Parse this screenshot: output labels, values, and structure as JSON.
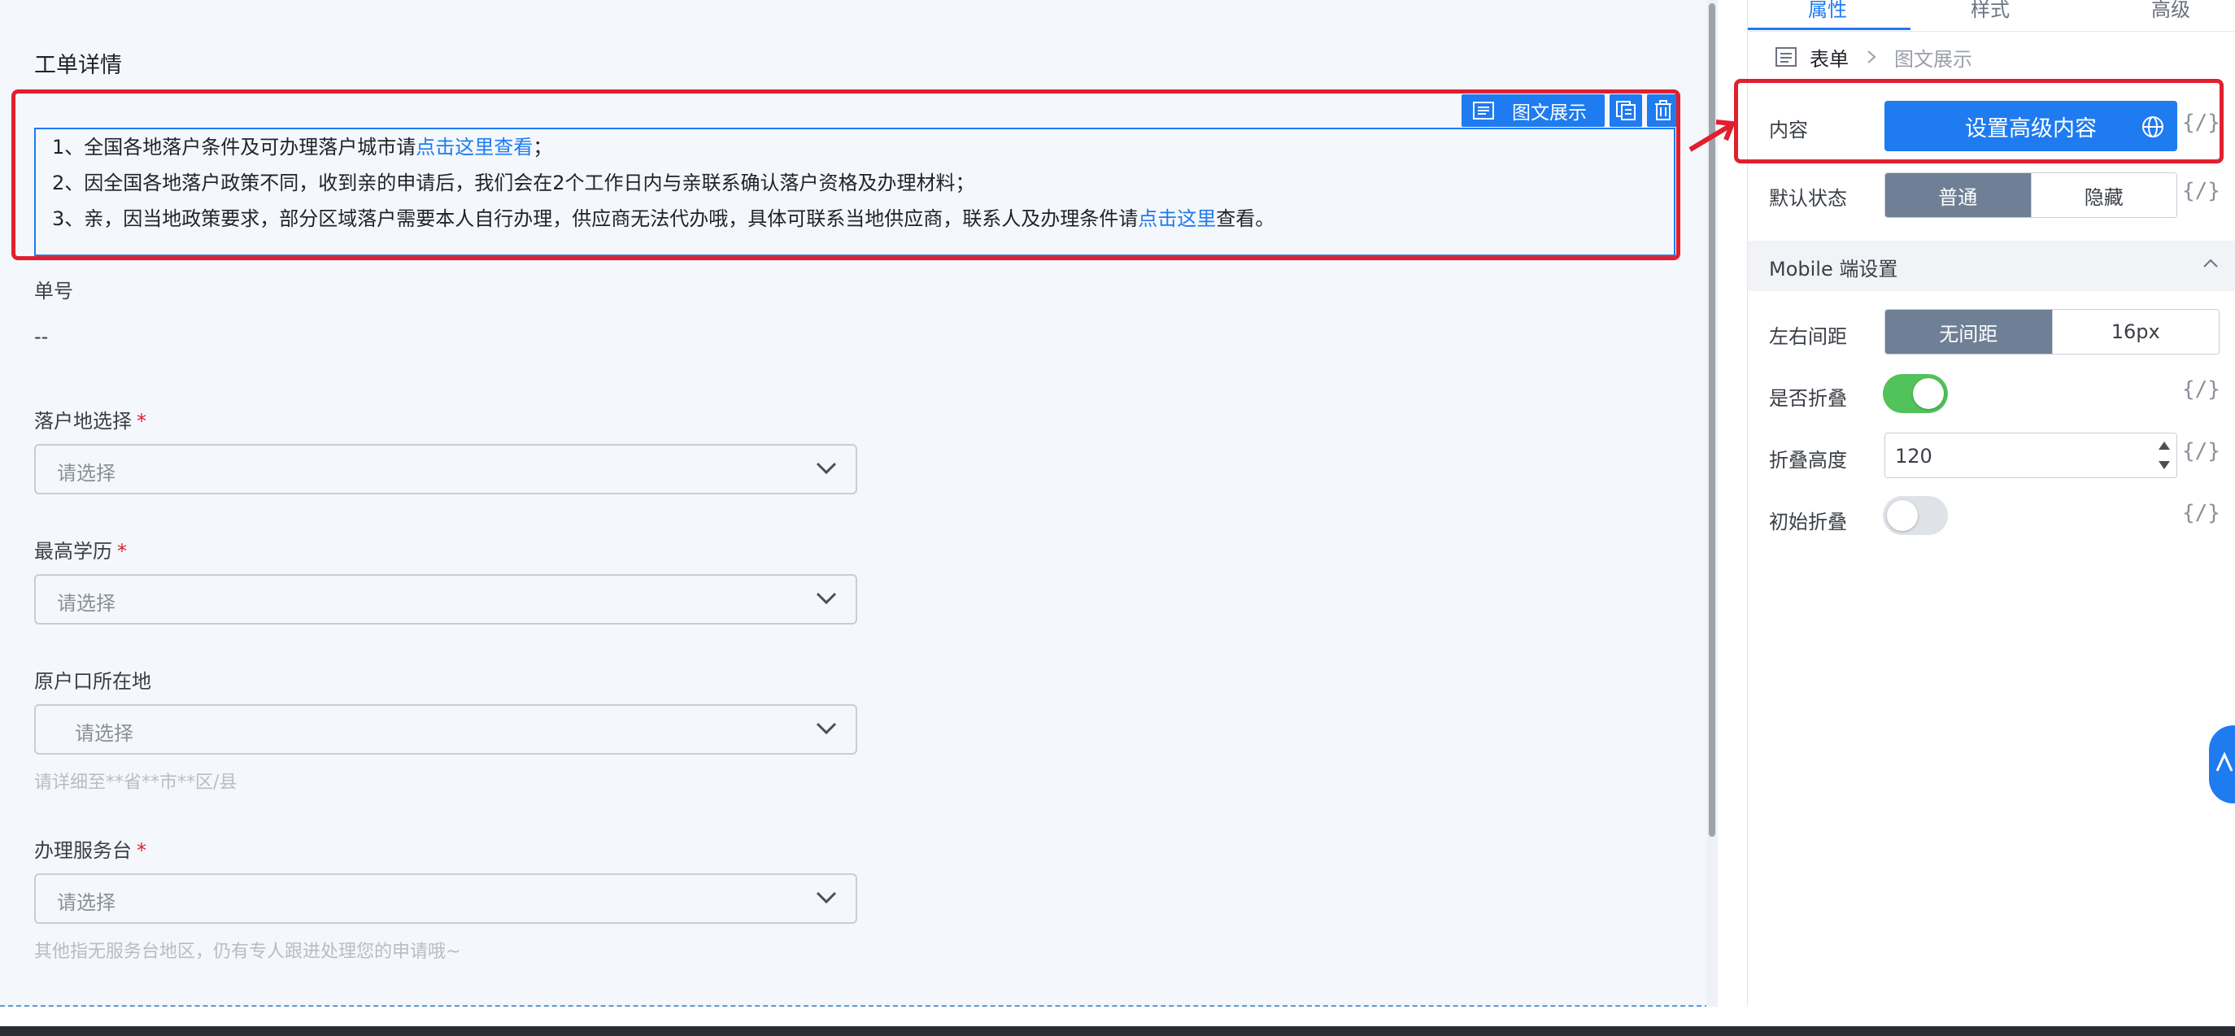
{
  "form": {
    "title": "工单详情",
    "rich_text": {
      "line1_text": "1、全国各地落户条件及可办理落户城市请",
      "line1_link": "点击这里查看",
      "line1_end": "；",
      "line2": "2、因全国各地落户政策不同，收到亲的申请后，我们会在2个工作日内与亲联系确认落户资格及办理材料；",
      "line3_text": "3、亲，因当地政策要求，部分区域落户需要本人自行办理，供应商无法代办哦，具体可联系当地供应商，联系人及办理条件请",
      "line3_link": "点击这里",
      "line3_end": "查看。"
    },
    "block_tag": "图文展示",
    "order_label": "单号",
    "order_value": "--",
    "fields": [
      {
        "label": "落户地选择",
        "required": "*",
        "placeholder": "请选择"
      },
      {
        "label": "最高学历",
        "required": "*",
        "placeholder": "请选择"
      },
      {
        "label": "原户口所在地",
        "placeholder": "请选择",
        "hint": "请详细至**省**市**区/县"
      },
      {
        "label": "办理服务台",
        "required": "*",
        "placeholder": "请选择",
        "hint": "其他指无服务台地区，仍有专人跟进处理您的申请哦~"
      }
    ]
  },
  "panel": {
    "tabs": [
      "属性",
      "样式",
      "高级"
    ],
    "breadcrumb": {
      "root": "表单",
      "current": "图文展示"
    },
    "expr_symbol": "{/}",
    "content_label": "内容",
    "content_button": "设置高级内容",
    "default_state_label": "默认状态",
    "default_state_options": [
      "普通",
      "隐藏"
    ],
    "default_state_selected": "普通",
    "mobile_section": "Mobile 端设置",
    "padding_label": "左右间距",
    "padding_options": [
      "无间距",
      "16px"
    ],
    "padding_selected": "无间距",
    "collapse_label": "是否折叠",
    "collapse_on": true,
    "collapse_height_label": "折叠高度",
    "collapse_height_value": "120",
    "initial_collapse_label": "初始折叠",
    "initial_collapse_on": false
  },
  "colors": {
    "accent": "#1e7bf0",
    "highlight": "#e0202e",
    "toggle_on": "#52c25a",
    "toggle_off": "#dfe3e8"
  }
}
